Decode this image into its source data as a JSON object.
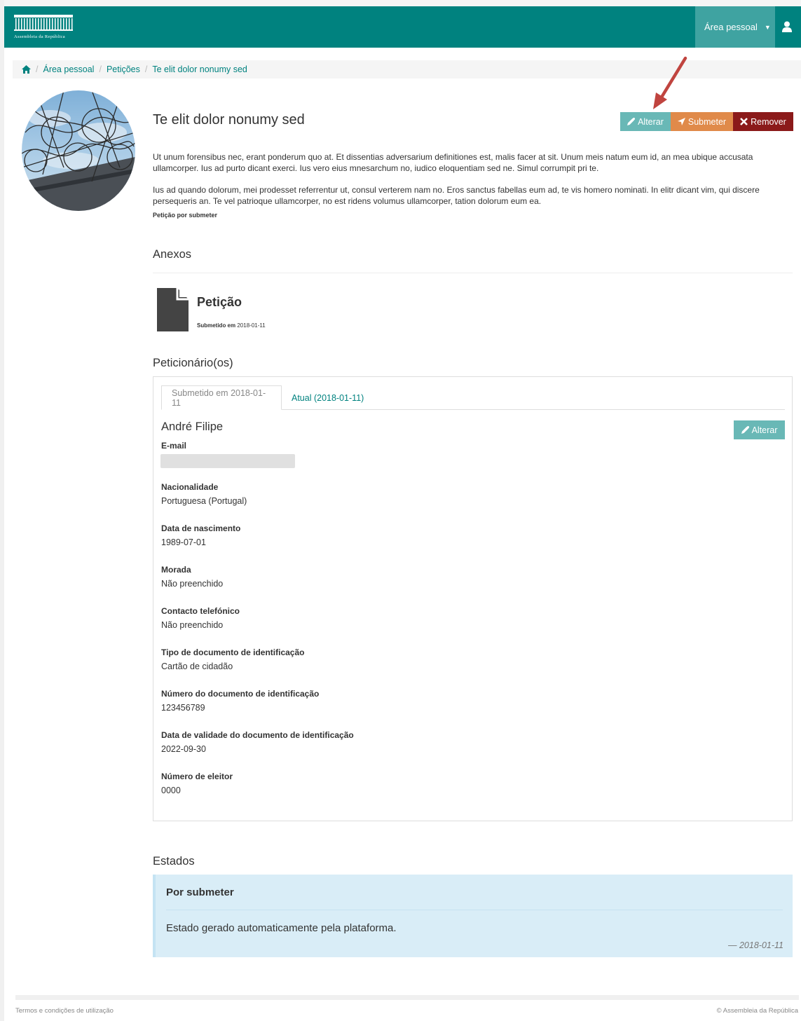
{
  "navbar": {
    "brand_text": "Assembleia da República",
    "user_menu_label": "Área pessoal",
    "color": "#00827f"
  },
  "breadcrumb": {
    "items": [
      "Área pessoal",
      "Petições",
      "Te elit dolor nonumy sed"
    ]
  },
  "petition": {
    "title": "Te elit dolor nonumy sed",
    "paragraph1": "Ut unum forensibus nec, erant ponderum quo at. Et dissentias adversarium definitiones est, malis facer at sit. Unum meis natum eum id, an mea ubique accusata ullamcorper. Ius ad purto dicant exerci. Ius vero eius mnesarchum no, iudico eloquentiam sed ne. Simul corrumpit pri te.",
    "paragraph2": "Ius ad quando dolorum, mei prodesset referrentur ut, consul verterem nam no. Eros sanctus fabellas eum ad, te vis homero nominati. In elitr dicant vim, qui discere persequeris an. Te vel patrioque ullamcorper, no est ridens volumus ullamcorper, tation dolorum eum ea.",
    "status_line": "Petição por submeter",
    "actions": {
      "alterar": "Alterar",
      "submeter": "Submeter",
      "remover": "Remover"
    }
  },
  "anexos": {
    "title": "Anexos",
    "document": {
      "name": "Petição",
      "date_label": "Submetido em",
      "date": "2018-01-11"
    }
  },
  "peticionarios": {
    "title": "Peticionário(os)",
    "tabs": [
      "Submetido em 2018-01-11",
      "Atual (2018-01-11)"
    ],
    "name": "André Filipe",
    "edit_label": "Alterar",
    "fields": [
      {
        "label": "E-mail",
        "value": ""
      },
      {
        "label": "Nacionalidade",
        "value": "Portuguesa (Portugal)"
      },
      {
        "label": "Data de nascimento",
        "value": "1989-07-01"
      },
      {
        "label": "Morada",
        "value": "Não preenchido"
      },
      {
        "label": "Contacto telefónico",
        "value": "Não preenchido"
      },
      {
        "label": "Tipo de documento de identificação",
        "value": "Cartão de cidadão"
      },
      {
        "label": "Número do documento de identificação",
        "value": "123456789"
      },
      {
        "label": "Data de validade do documento de identificação",
        "value": "2022-09-30"
      },
      {
        "label": "Número de eleitor",
        "value": "0000"
      }
    ]
  },
  "estados": {
    "title": "Estados",
    "items": [
      {
        "name": "Por submeter",
        "text": "Estado gerado automaticamente pela plataforma.",
        "date": "— 2018-01-11"
      }
    ]
  },
  "footer": {
    "left": "Termos e condições de utilização",
    "right": "© Assembleia da República"
  }
}
